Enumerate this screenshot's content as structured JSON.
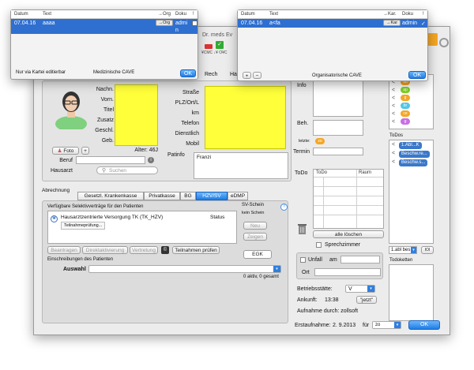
{
  "main_window": {
    "title_partial": "Dr. meds Ev",
    "menu_right": {
      "item1": "Rech",
      "item2": "Hau"
    },
    "toolbar_small": "¥CMC ↓¥ O¥C"
  },
  "patient": {
    "labels": {
      "nachname": "Nachn.",
      "vorname": "Vorn.",
      "titel": "Titel",
      "zusatz": "Zusatz",
      "geschlecht": "Geschl.",
      "geb": "Geb."
    },
    "alter": "Alter: 46J",
    "foto_button": "Foto",
    "plus_button": "+",
    "beruf_label": "Beruf",
    "hausarzt_label": "Hausarzt",
    "hausarzt_placeholder": "Suchen"
  },
  "address": {
    "labels": {
      "strasse": "Straße",
      "plz": "PLZ/Ort/L",
      "km": "km",
      "telefon": "Telefon",
      "dienstlich": "Dienstlich",
      "mobil": "Mobil"
    },
    "patinfo_label": "Patinfo",
    "patinfo_value": "Franzi"
  },
  "abrechnung": {
    "label": "Abrechnung",
    "tabs": [
      "Gesetzl. Krankenkasse",
      "Privatkasse",
      "BG",
      "HZV/SV",
      "eDMP"
    ],
    "active_tab": 3,
    "vertraege_header": "Verfügbare Selektivverträge für den Patienten",
    "status_header": "Status",
    "contract_name": "Hausarztzentrierte Versorgung TK (TK_HZV)",
    "contract_sub": "Teilnahmeprüfung...",
    "sv_schein": "SV-Schein",
    "kein_schein": "kein Schein",
    "neu": "Neu",
    "zeigen": "Zeigen",
    "egk": "EGK",
    "action_buttons": [
      "Beantragen",
      "Direktaktivierung",
      "Vertretung"
    ],
    "teilnahmen_pruefen": "Teilnahmen prüfen",
    "einschreibungen": "Einschreibungen des Patienten",
    "auswahl_label": "Auswahl",
    "count_text": "0 aktiv, 0 gesamt",
    "help": "?"
  },
  "middle": {
    "info_label": "Info",
    "beh_label": "Beh.",
    "letzte_label": "letzte:",
    "letzte_chip": "zo",
    "termin_label": "Termin",
    "todo_label": "ToDo",
    "todo_cols": [
      "ToDo",
      "Raum"
    ],
    "alle_loeschen": "alle löschen",
    "sprechzimmer": "Sprechzimmer",
    "unfall_label": "Unfall",
    "am_label": "am",
    "ort_label": "Ort",
    "betriebsstaette_label": "Betriebsstätte:",
    "betriebsstaette_value": "V",
    "ankunft_label": "Ankunft:",
    "ankunft_value": "13:38",
    "jetzt_button": "\"jetzt\"",
    "aufnahme_text": "Aufnahme durch: zollsoft"
  },
  "right": {
    "chips": [
      {
        "text": "ab",
        "color": "#f5a623"
      },
      {
        "text": "ap",
        "color": "#7ed321"
      },
      {
        "text": "g",
        "color": "#f5a623"
      },
      {
        "text": "br",
        "color": "#50c8e6"
      },
      {
        "text": "ce",
        "color": "#f5a623"
      },
      {
        "text": "g",
        "color": "#c86ee6"
      }
    ],
    "todos_label": "ToDos",
    "todo_items": [
      "1.Abl...K",
      "Beschw.re...",
      "Beschw.s..."
    ],
    "abl_value": "1.abl bes",
    "abl_btn": "IOI",
    "todoketten_label": "Todoketten"
  },
  "footer": {
    "erstaufnahme_label": "Erstaufnahme:",
    "erstaufnahme_value": "2. 9.2013",
    "fuer_label": "für",
    "fuer_value": "zo",
    "ok": "OK"
  },
  "popup_left": {
    "columns": [
      "Datum",
      "Text",
      "→Org",
      "Doku",
      "!"
    ],
    "row": {
      "datum": "07.04.16",
      "text": "aaaa",
      "org": "→Org",
      "doku": "admi",
      "doku2": "n"
    },
    "footer_left": "Nur via Kartei editierbar",
    "footer_center": "Medizinische CAVE",
    "ok": "OK"
  },
  "popup_right": {
    "columns": [
      "Datum",
      "Text",
      "→Kar.",
      "Doku",
      "!"
    ],
    "row": {
      "datum": "07.04.16",
      "text": "a<fa",
      "kar": "→Kar",
      "doku": "admin",
      "check": "✓"
    },
    "footer_center": "Organisatorische CAVE",
    "plus": "+",
    "minus": "−",
    "ok": "OK"
  }
}
